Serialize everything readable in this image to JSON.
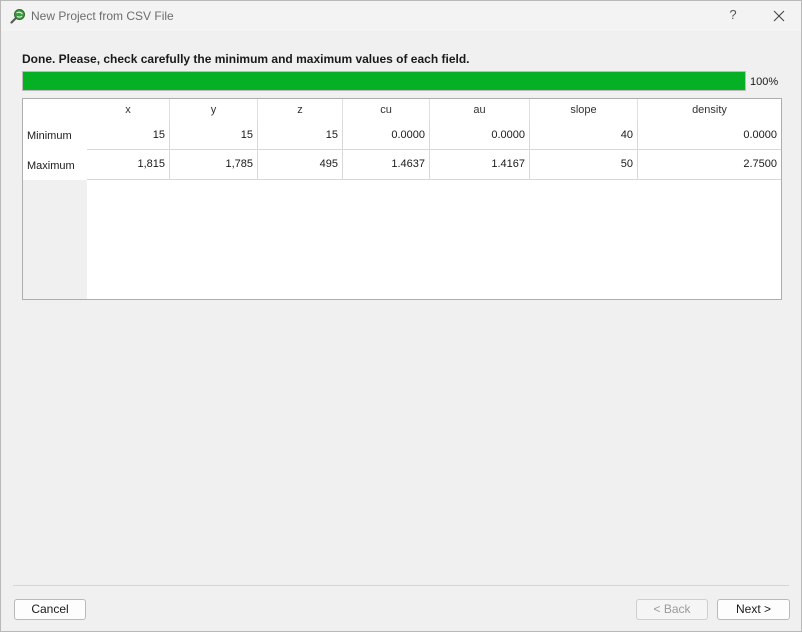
{
  "window": {
    "title": "New Project from CSV File",
    "help_label": "?",
    "icons": {
      "app": "magnifier-globe-icon",
      "close": "close-icon"
    }
  },
  "headline": "Done. Please, check carefully the minimum and maximum values of each field.",
  "progress": {
    "value": 1.0,
    "label": "100%",
    "color": "#06b025"
  },
  "table": {
    "columns": [
      "x",
      "y",
      "z",
      "cu",
      "au",
      "slope",
      "density"
    ],
    "rows": [
      {
        "label": "Minimum",
        "values": [
          "15",
          "15",
          "15",
          "0.0000",
          "0.0000",
          "40",
          "0.0000"
        ]
      },
      {
        "label": "Maximum",
        "values": [
          "1,815",
          "1,785",
          "495",
          "1.4637",
          "1.4167",
          "50",
          "2.7500"
        ]
      }
    ]
  },
  "buttons": {
    "cancel": "Cancel",
    "back": "< Back",
    "next": "Next >"
  }
}
